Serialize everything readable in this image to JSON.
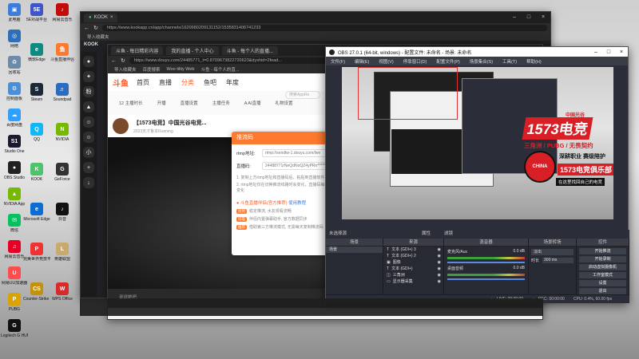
{
  "desktop": {
    "icons": [
      {
        "label": "此电脑",
        "color": "#3b7dd8",
        "glyph": "▣"
      },
      {
        "label": "网络",
        "color": "#2f6fb8",
        "glyph": "◎"
      },
      {
        "label": "回收站",
        "color": "#6d8aa8",
        "glyph": "♻"
      },
      {
        "label": "控制面板",
        "color": "#4a90d9",
        "glyph": "⚙"
      },
      {
        "label": "百度网盘",
        "color": "#2fa0ff",
        "glyph": "☁"
      },
      {
        "label": "Studio One",
        "color": "#1a1a2e",
        "glyph": "S1"
      },
      {
        "label": "OBS Studio",
        "color": "#222",
        "glyph": "●"
      },
      {
        "label": "NVIDIA App",
        "color": "#76b900",
        "glyph": "▲"
      },
      {
        "label": "微信",
        "color": "#07c160",
        "glyph": "✉"
      },
      {
        "label": "网易云音乐",
        "color": "#e60026",
        "glyph": "♫"
      },
      {
        "label": "网易UU加速器",
        "color": "#ff4d4d",
        "glyph": "U"
      },
      {
        "label": "PUBG",
        "color": "#d9a400",
        "glyph": "P"
      },
      {
        "label": "Logitech G HUB",
        "color": "#111",
        "glyph": "G"
      }
    ],
    "icons_col2": [
      {
        "label": "5E对战平台",
        "color": "#4055c8",
        "glyph": "5E"
      },
      {
        "label": "微软Edge",
        "color": "#0c8c80",
        "glyph": "e"
      },
      {
        "label": "Steam",
        "color": "#1b2838",
        "glyph": "S"
      },
      {
        "label": "QQ",
        "color": "#12b7f5",
        "glyph": "Q"
      },
      {
        "label": "KOOK",
        "color": "#4fc36b",
        "glyph": "K"
      },
      {
        "label": "Microsoft Edge",
        "color": "#0b6cd1",
        "glyph": "e"
      },
      {
        "label": "完美世界竞技平台",
        "color": "#e33",
        "glyph": "P"
      },
      {
        "label": "Counter-Strike 2",
        "color": "#c2910f",
        "glyph": "CS"
      }
    ],
    "icons_col3": [
      {
        "label": "网易云音乐",
        "color": "#c20c0c",
        "glyph": "♪"
      },
      {
        "label": "斗鱼直播伴侣",
        "color": "#ff7a2f",
        "glyph": "鱼"
      },
      {
        "label": "Soundpad",
        "color": "#2a6cc0",
        "glyph": "♬"
      },
      {
        "label": "NVIDIA",
        "color": "#76b900",
        "glyph": "N"
      },
      {
        "label": "GeForce",
        "color": "#333",
        "glyph": "G"
      },
      {
        "label": "抖音",
        "color": "#111",
        "glyph": "♪"
      },
      {
        "label": "英雄联盟",
        "color": "#c8aa6e",
        "glyph": "L"
      },
      {
        "label": "WPS Office",
        "color": "#d52b2b",
        "glyph": "W"
      }
    ]
  },
  "kook_window": {
    "tab_title": "KOOK",
    "url": "https://www.kookapp.cn/app/channels/1620980209131152/1535831406741233",
    "bookmark": "导入收藏夹",
    "app_name": "KOOK",
    "side_glyphs": [
      "●",
      "✦",
      "粉",
      "▲",
      "☺",
      "☺",
      "小",
      "+",
      "↓"
    ]
  },
  "douyu_window": {
    "tabs": [
      "斗鱼 - 每日精彩内容",
      "我的直播 - 个人中心",
      "斗鱼 - 每个人的直播..."
    ],
    "url": "https://www.douyu.com/24485771_t=0.8709673822720623&dyshid=2fead...",
    "bookmarks": [
      "导入收藏夹",
      "百度搜索",
      "Woo tility Web",
      "斗鱼 - 每个人的直..."
    ],
    "logo": "斗鱼",
    "nav": [
      "首页",
      "直播",
      "分类",
      "鱼吧",
      "年度"
    ],
    "search_placeholder": "搜索AppRe",
    "cats": [
      "12 主播时长",
      "开播",
      "直播设置",
      "主播任务",
      "A AI直播",
      "礼物设置"
    ],
    "room_title": "【1573电竞】中国光谷电竞...",
    "room_sub": "2023天才鲁本Running",
    "chat_placeholder": "说说她吧"
  },
  "modal": {
    "title": "推流码",
    "rtmp_label": "rtmp地址:",
    "rtmp_value": "rtmp://sendtw-1.douyu.com/live",
    "key_label": "直播码:",
    "key_value": "24488771rNeQdNoQZ4yPRn*******",
    "note1": "1. 复制上方rtmp地址和直播码后，粘贴到直播软件中",
    "note2": "2. rtmp地址仅在切换推流线路时会变化，直播码每次开播均会变化",
    "promo_title": "斗鱼直播伴侣(官方推荐)",
    "promo_link": "使用教程",
    "promo_lines": [
      {
        "tag": "优势",
        "text": "稳定推流, 水友观看流畅"
      },
      {
        "tag": "可靠",
        "text": "伴侣内置弹幕助手, 官方数据同步"
      },
      {
        "tag": "推荐",
        "text": "借助第三方推流模式, 无需每天复制推流码"
      }
    ]
  },
  "obs": {
    "title": "OBS 27.0.1 (64-bit, windows) - 配置文件: 未命名 - 场景: 未命名",
    "menu": [
      "文件(F)",
      "编辑(E)",
      "视图(V)",
      "停靠窗口(D)",
      "配置文件(P)",
      "场景集合(S)",
      "工具(T)",
      "帮助(H)"
    ],
    "source_selected": "未选择源",
    "properties": "属性",
    "filters": "滤镜",
    "docks": {
      "scenes_title": "场景",
      "scene_item": "场景",
      "sources_title": "来源",
      "sources": [
        {
          "icon": "T",
          "name": "文本 (GDI+) 3"
        },
        {
          "icon": "T",
          "name": "文本 (GDI+) 2"
        },
        {
          "icon": "▣",
          "name": "图像"
        },
        {
          "icon": "T",
          "name": "文本 (GDI+)"
        },
        {
          "icon": "◫",
          "name": "三角洲"
        },
        {
          "icon": "▭",
          "name": "显示器采集"
        }
      ],
      "mixer_title": "混音器",
      "mixer": [
        {
          "name": "麦克风/Aux",
          "db": "0.0 dB"
        },
        {
          "name": "桌面音频",
          "db": "0.0 dB"
        }
      ],
      "transitions_title": "场景转场",
      "transition_value": "淡出",
      "duration_label": "时长",
      "duration_value": "300 ms",
      "controls_title": "控件",
      "controls": [
        "开始推流",
        "开始录制",
        "启动虚拟摄像机",
        "工作室模式",
        "设置",
        "退出"
      ]
    },
    "status": {
      "live": "LIVE: 00:00:00",
      "rec": "REC: 00:00:00",
      "cpu": "CPU: 0.4%, 60.00 fps"
    },
    "overlay": {
      "brand_big": "1573电竞",
      "brand_small": "中国光谷",
      "line1": "三角洲 / PUBG / 无畏契约",
      "line2": "深耕职业  赛级陪护",
      "line3": "1573电竞俱乐部",
      "badge": "CHINA",
      "footer": "在这里找回自己的电竞"
    }
  },
  "colors": {
    "douyu_orange": "#ff7a2f",
    "obs_bg": "#2b2e38",
    "brand_red": "#d81f26"
  }
}
